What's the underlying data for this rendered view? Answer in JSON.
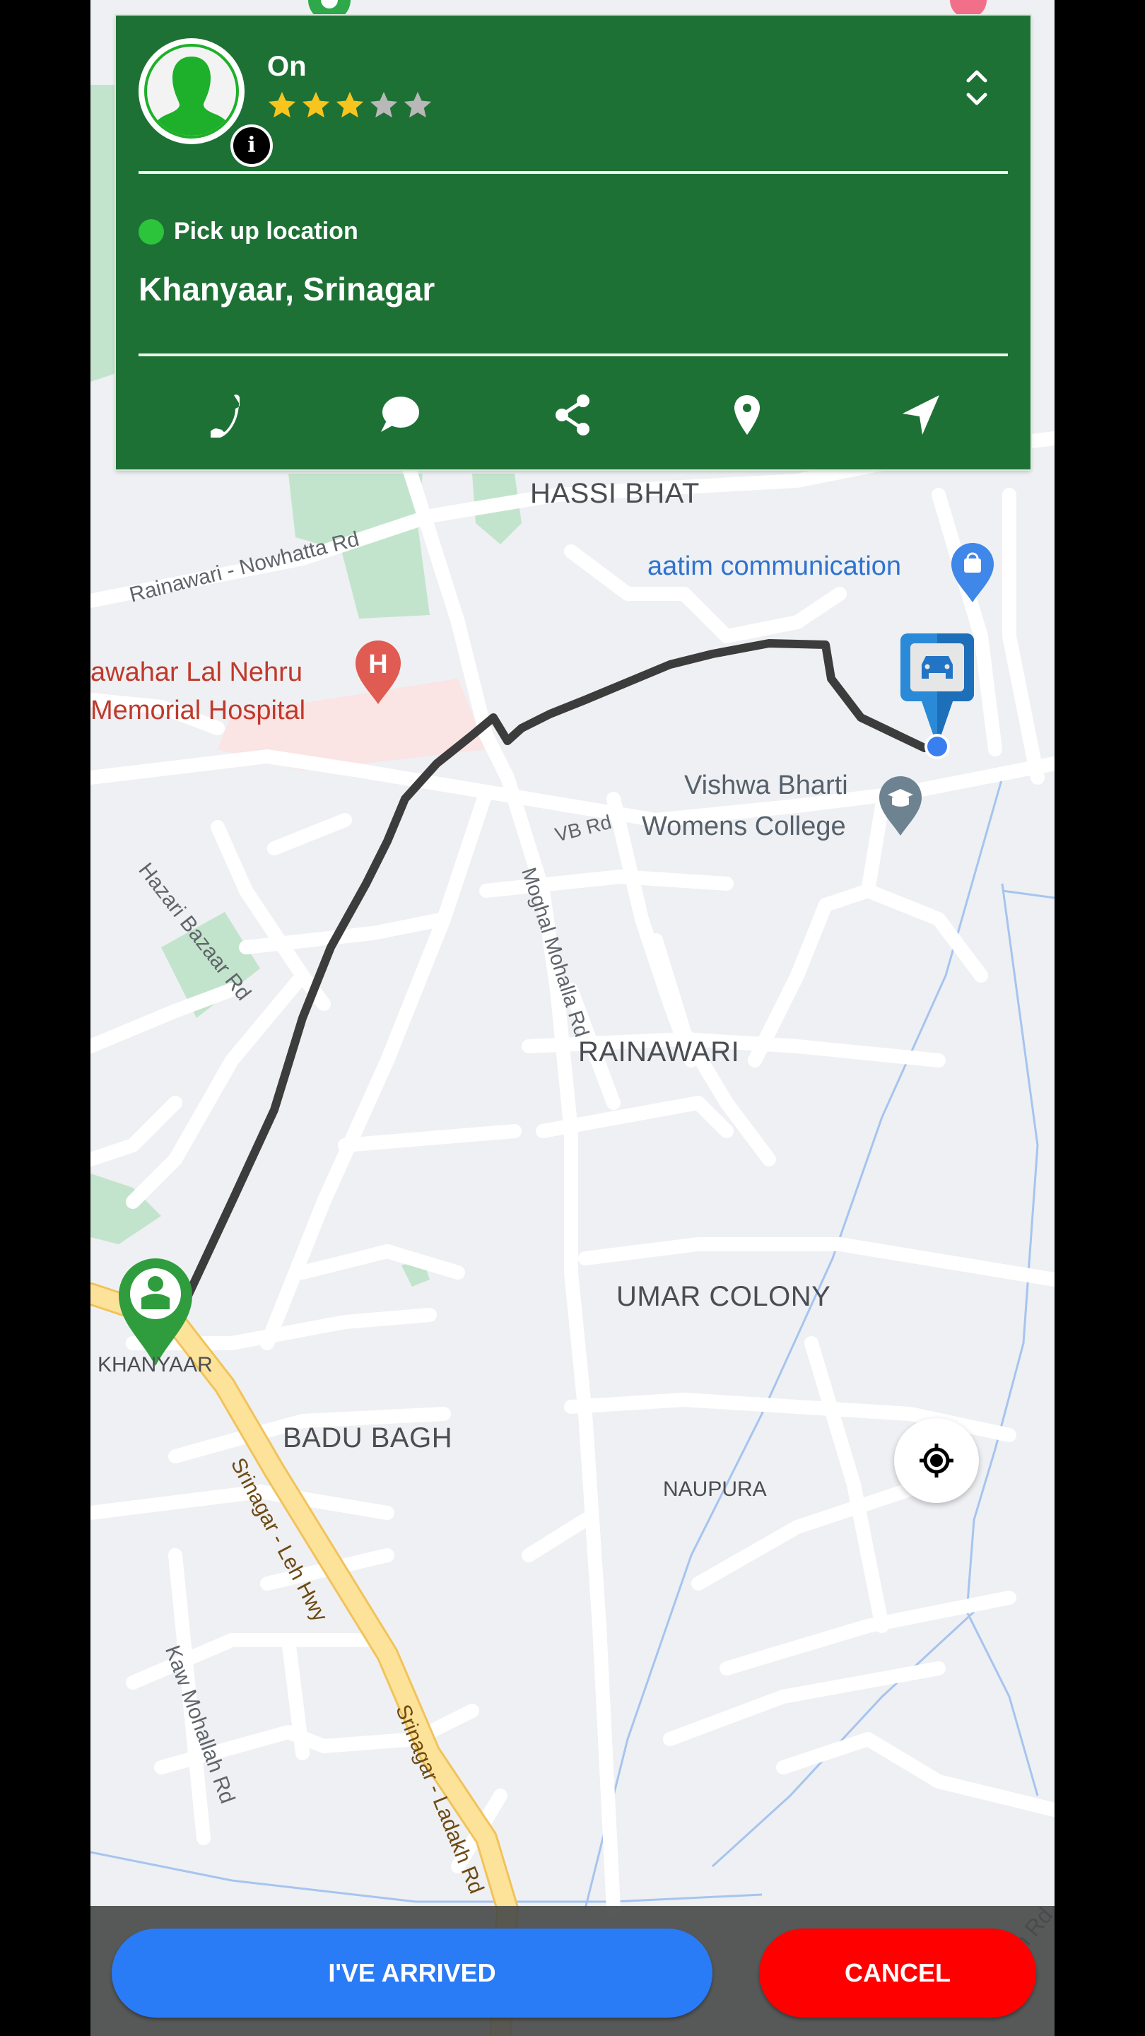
{
  "driver": {
    "name": "On",
    "rating": 3,
    "rating_max": 5,
    "avatar_icon": "person-silhouette-icon",
    "info_icon": "info-icon",
    "info_glyph": "i"
  },
  "card": {
    "expand_icon": "chevron-up-down-icon",
    "pickup_label": "Pick up location",
    "pickup_address": "Khanyaar, Srinagar",
    "actions": [
      {
        "id": "call",
        "icon": "phone-icon"
      },
      {
        "id": "message",
        "icon": "chat-bubble-icon"
      },
      {
        "id": "share",
        "icon": "share-icon"
      },
      {
        "id": "location",
        "icon": "map-pin-icon"
      },
      {
        "id": "navigate",
        "icon": "navigation-arrow-icon"
      }
    ]
  },
  "map": {
    "labels": {
      "hassi_bhat": "HASSI BHAT",
      "rainawari_road": "Rainawari - Nowhatta Rd",
      "aatim": "aatim communication",
      "hospital_line1": "awahar Lal Nehru",
      "hospital_line2": "Memorial Hospital",
      "vishwa_line1": "Vishwa Bharti",
      "vishwa_line2": "Womens College",
      "vb_rd": "VB Rd",
      "hazari": "Hazari Bazaar Rd",
      "moghal": "Moghal Mohalla Rd",
      "rainawari": "RAINAWARI",
      "umar_colony": "UMAR COLONY",
      "khanyaar": "KHANYAAR",
      "badu_bagh": "BADU BAGH",
      "naupura": "NAUPURA",
      "leh_hwy": "Srinagar - Leh Hwy",
      "ladakh_rd": "Srinagar - Ladakh Rd",
      "kaw_mohallah": "Kaw Mohallah Rd",
      "edge_rd": "an Rd"
    },
    "markers": {
      "driver": "car-marker-icon",
      "pickup": "person-pin-icon",
      "hospital": "hospital-pin-icon",
      "shop": "shopping-bag-pin-icon",
      "college": "graduation-cap-pin-icon"
    },
    "locate_icon": "my-location-icon"
  },
  "footer": {
    "arrived_label": "I'VE ARRIVED",
    "cancel_label": "CANCEL"
  },
  "colors": {
    "card_bg": "#1e7135",
    "star_on": "#f7c51e",
    "star_off": "#b8b8b8",
    "pickup_dot": "#2bc43b",
    "arrived": "#2a7bf6",
    "cancel": "#ff0000",
    "route": "#3c3c3c"
  }
}
